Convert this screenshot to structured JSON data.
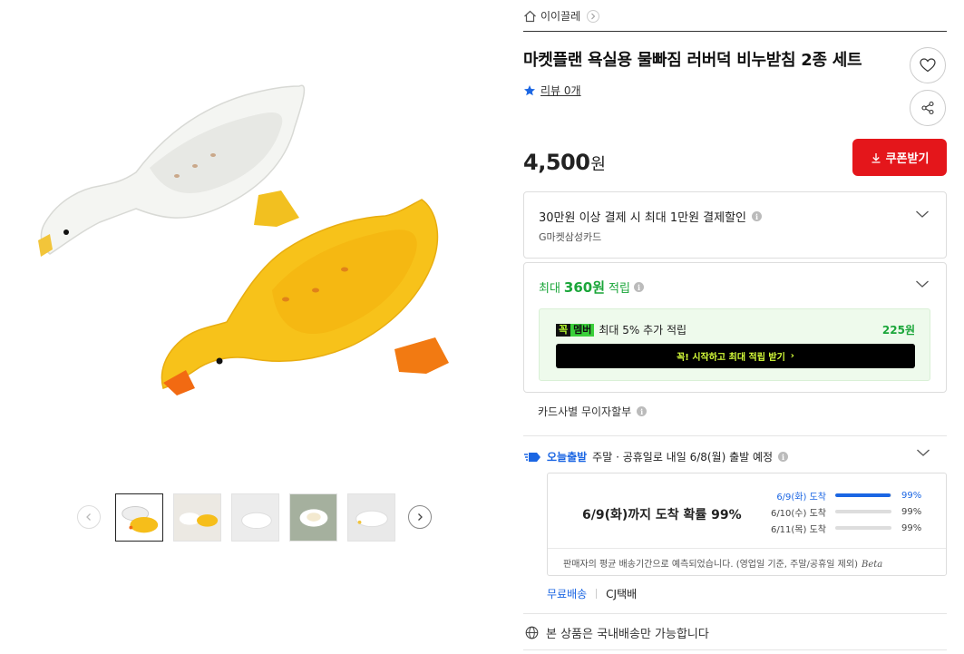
{
  "breadcrumb": {
    "label": "이이끌레"
  },
  "product": {
    "title": "마켓플랜 욕실용 물빠짐 러버덕 비누받침 2종 세트",
    "review_label": "리뷰 0개",
    "price": "4,500",
    "price_unit": "원",
    "coupon_label": "쿠폰받기"
  },
  "benefits": {
    "card_discount": "30만원 이상 결제 시 최대 1만원 결제할인",
    "card_name": "G마켓삼성카드",
    "points_prefix": "최대",
    "points_amount": "360원",
    "points_suffix": "적립",
    "member_badge_1": "꼭",
    "member_badge_2": "멤버",
    "member_text": "최대 5% 추가 적립",
    "member_amount": "225원",
    "member_cta": "꼭! 시작하고 최대 적립 받기",
    "member_cta_arrow": "›",
    "installment": "카드사별 무이자할부"
  },
  "shipping": {
    "today_label": "오늘출발",
    "notice": "주말 · 공휴일로 내일 6/8(월) 출발 예정",
    "probability_title": "6/9(화)까지 도착 확률 99%",
    "rows": [
      {
        "date": "6/9(화) 도착",
        "percent": "99%",
        "fill": 0.99
      },
      {
        "date": "6/10(수) 도착",
        "percent": "99%",
        "fill": 0
      },
      {
        "date": "6/11(목) 도착",
        "percent": "99%",
        "fill": 0
      }
    ],
    "note": "판매자의 평균 배송기간으로 예측되었습니다. (영업일 기준, 주말/공휴일 제외)",
    "beta": "Beta",
    "free_label": "무료배송",
    "carrier": "CJ택배",
    "domestic": "본 상품은 국내배송만 가능합니다"
  },
  "colors": {
    "accent_red": "#e4161b",
    "accent_blue": "#1b66e3",
    "accent_green": "#1ba63a"
  }
}
